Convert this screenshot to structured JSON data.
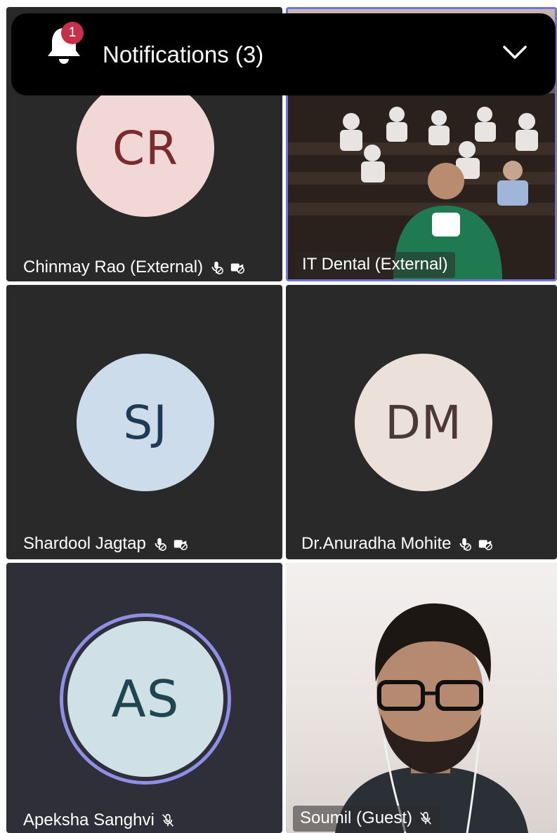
{
  "notification_banner": {
    "title": "Notifications (3)",
    "badge_count": "1",
    "icon": "bell-icon",
    "expand_icon": "chevron-down-icon"
  },
  "participants": [
    {
      "name": "Chinmay Rao (External)",
      "initials": "CR",
      "avatar_bg": "#f2d7d7",
      "initials_color": "#7a2b2e",
      "mic": "mic-off-icon",
      "camera": "camera-off-icon"
    },
    {
      "name": "IT Dental (External)",
      "video": "on",
      "active_speaker": true
    },
    {
      "name": "Shardool Jagtap",
      "initials": "SJ",
      "avatar_bg": "#cddcea",
      "initials_color": "#1f3a57",
      "mic": "mic-off-icon",
      "camera": "camera-off-icon"
    },
    {
      "name": "Dr.Anuradha Mohite",
      "initials": "DM",
      "avatar_bg": "#ece0da",
      "initials_color": "#4a3a33",
      "mic": "mic-off-icon",
      "camera": "camera-off-icon"
    },
    {
      "name": "Apeksha Sanghvi",
      "initials": "AS",
      "avatar_bg": "#cfe1e6",
      "initials_color": "#1f4650",
      "mic": "mic-muted-icon",
      "speaking_ring": true
    },
    {
      "name": "Soumil (Guest)",
      "video": "on",
      "mic": "mic-muted-icon"
    }
  ],
  "colors": {
    "tile_bg": "#292929",
    "active_border": "#7075d6",
    "badge": "#c4314b"
  }
}
